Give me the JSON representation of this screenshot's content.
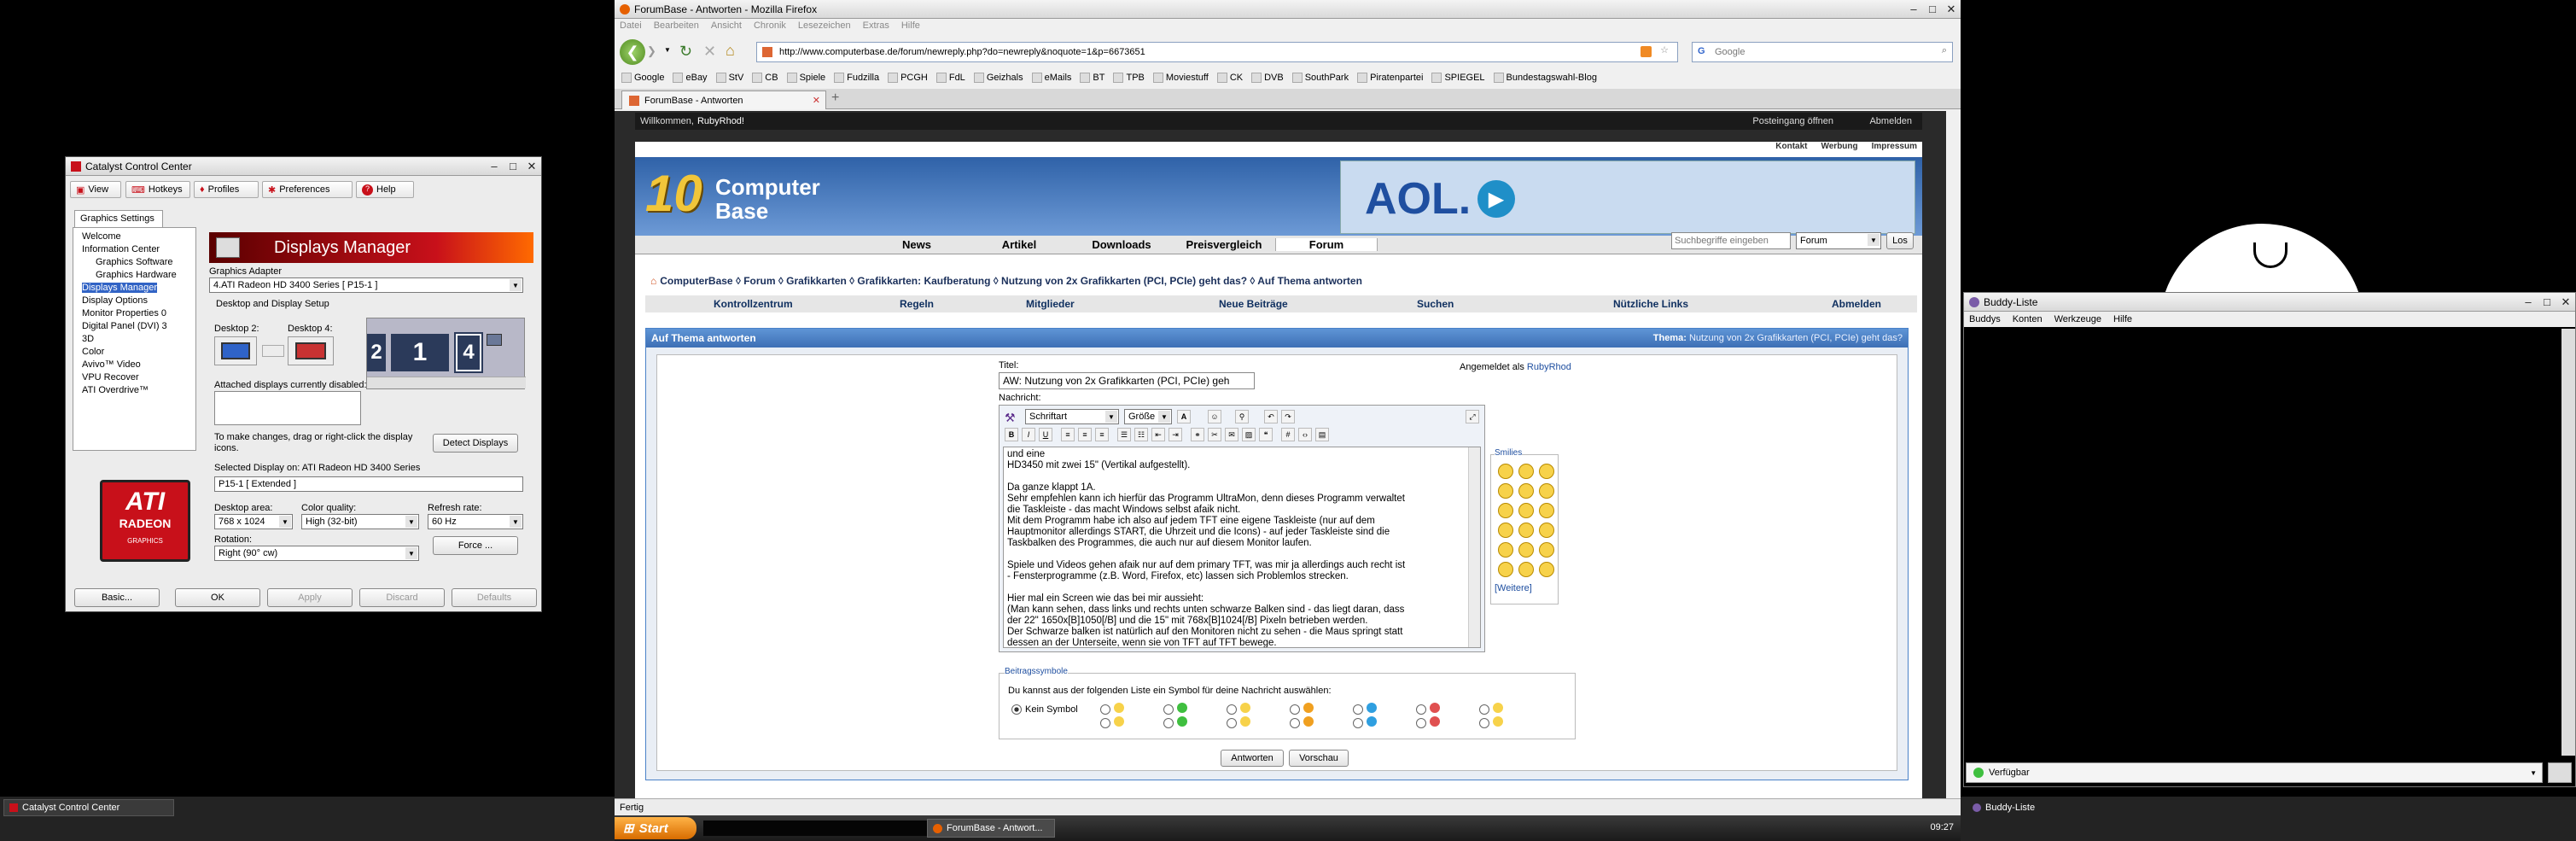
{
  "ccc": {
    "title": "Catalyst Control Center",
    "toolbar": [
      "View",
      "Hotkeys",
      "Profiles",
      "Preferences",
      "Help"
    ],
    "tab": "Graphics Settings",
    "tree": [
      "Welcome",
      "Information Center",
      "Graphics Software",
      "Graphics Hardware",
      "Displays Manager",
      "Display Options",
      "Monitor Properties 0",
      "Digital Panel (DVI) 3",
      "3D",
      "Color",
      "Avivo™ Video",
      "VPU Recover",
      "ATI Overdrive™"
    ],
    "tree_selected": "Displays Manager",
    "logo_text": [
      "ATI",
      "RADEON",
      "GRAPHICS"
    ],
    "panel_title": "Displays Manager",
    "adapter_label": "Graphics Adapter",
    "adapter_value": "4.ATI Radeon HD 3400 Series  [ P15-1 ]",
    "desktop_setup": "Desktop and Display Setup",
    "desktop2": "Desktop 2:",
    "desktop4": "Desktop 4:",
    "monitor_numbers": [
      "2",
      "1",
      "4"
    ],
    "attached_disabled": "Attached displays currently disabled:",
    "hint_line1": "To make changes, drag or right-click the display",
    "hint_line2": "icons.",
    "detect": "Detect Displays",
    "selected_display": "Selected Display on: ATI Radeon HD 3400 Series",
    "display_value": "P15-1  [ Extended ]",
    "desktop_area_label": "Desktop area:",
    "desktop_area": "768 x 1024",
    "color_quality_label": "Color quality:",
    "color_quality": "High (32-bit)",
    "refresh_label": "Refresh rate:",
    "refresh": "60 Hz",
    "rotation_label": "Rotation:",
    "rotation": "Right (90° cw)",
    "force": "Force ...",
    "buttons": [
      "Basic...",
      "OK",
      "Apply",
      "Discard",
      "Defaults"
    ]
  },
  "firefox": {
    "title": "ForumBase - Antworten - Mozilla Firefox",
    "menu": [
      "Datei",
      "Bearbeiten",
      "Ansicht",
      "Chronik",
      "Lesezeichen",
      "Extras",
      "Hilfe"
    ],
    "url": "http://www.computerbase.de/forum/newreply.php?do=newreply&noquote=1&p=6673651",
    "search_placeholder": "Google",
    "bookmarks": [
      "Google",
      "eBay",
      "StV",
      "CB",
      "Spiele",
      "Fudzilla",
      "PCGH",
      "FdL",
      "Geizhals",
      "eMails",
      "BT",
      "TPB",
      "Moviestuff",
      "CK",
      "DVB",
      "SouthPark",
      "Piratenpartei",
      "SPIEGEL",
      "Bundestagswahl-Blog"
    ],
    "tab": "ForumBase - Antworten",
    "status": "Fertig"
  },
  "forum": {
    "welcome": "Willkommen,",
    "user": "RubyRhod!",
    "postbox": "Posteingang öffnen",
    "logout_top": "Abmelden",
    "toplinks": [
      "Kontakt",
      "Werbung",
      "Impressum"
    ],
    "logo_10": "10",
    "logo_computer": "Computer",
    "logo_base": "Base",
    "ad": "AOL.",
    "nav": [
      "News",
      "Artikel",
      "Downloads",
      "Preisvergleich",
      "Forum"
    ],
    "search_placeholder": "Suchbegriffe eingeben",
    "search_scope": "Forum",
    "search_btn": "Los",
    "breadcrumb": "ComputerBase  ◊ Forum  ◊ Grafikkarten  ◊ Grafikkarten: Kaufberatung  ◊ Nutzung von 2x Grafikkarten (PCI, PCIe) geht das?  ◊ Auf Thema antworten",
    "subnav": [
      "Kontrollzentrum",
      "Regeln",
      "Mitglieder",
      "Neue Beiträge",
      "Suchen",
      "Nützliche Links",
      "Abmelden"
    ],
    "panel_title": "Auf Thema antworten",
    "thema_label": "Thema:",
    "thema": "Nutzung von 2x Grafikkarten (PCI, PCIe) geht das?",
    "titel_label": "Titel:",
    "titel_value": "AW: Nutzung von 2x Grafikkarten (PCI, PCIe) geh",
    "logged_as": "Angemeldet als",
    "logged_user": "RubyRhod",
    "nachricht_label": "Nachricht:",
    "font_select": "Schriftart",
    "size_select": "Größe",
    "message": [
      "und eine",
      "HD3450 mit zwei 15\" (Vertikal aufgestellt).",
      "",
      "Da ganze klappt 1A.",
      "Sehr empfehlen kann ich hierfür das Programm UltraMon, denn dieses Programm verwaltet",
      "die Taskleiste - das macht Windows selbst afaik nicht.",
      "Mit dem Programm habe ich also auf jedem TFT eine eigene Taskleiste (nur auf dem",
      "Hauptmonitor allerdings START, die Uhrzeit und die Icons) - auf jeder Taskleiste sind die",
      "Taskbalken des Programmes, die auch nur auf diesem Monitor laufen.",
      "",
      "Spiele und Videos gehen afaik nur auf dem primary TFT, was mir ja allerdings auch recht ist",
      "- Fensterprogramme (z.B. Word, Firefox, etc) lassen sich Problemlos strecken.",
      "",
      "Hier mal ein Screen wie das bei mir aussieht:",
      "(Man kann sehen, dass links und rechts unten schwarze Balken sind - das liegt daran, dass",
      "der 22\" 1650x[B]1050[/B] und die 15\" mit 768x[B]1024[/B] Pixeln betrieben werden.",
      "Der Schwarze balken ist natürlich auf den Monitoren nicht zu sehen - die Maus springt statt",
      "dessen an der Unterseite, wenn sie von TFT auf TFT bewege."
    ],
    "smilies_label": "Smilies",
    "more": "[Weitere]",
    "symbols_label": "Beitragssymbole",
    "symbols_text": "Du kannst aus der folgenden Liste ein Symbol für deine Nachricht auswählen:",
    "no_symbol": "Kein Symbol",
    "submit": "Antworten",
    "preview": "Vorschau"
  },
  "buddy": {
    "title": "Buddy-Liste",
    "menu": [
      "Buddys",
      "Konten",
      "Werkzeuge",
      "Hilfe"
    ],
    "status": "Verfügbar"
  },
  "taskbars": {
    "left_item": "Catalyst Control Center",
    "start": "Start",
    "center_item": "ForumBase - Antwort...",
    "clock": "09:27",
    "right_item": "Buddy-Liste"
  },
  "colors": {
    "forum_blue": "#3d6fb5",
    "panel_header": "#4a82c8",
    "ati_red": "#c8101a",
    "taskbar": "#232323"
  }
}
